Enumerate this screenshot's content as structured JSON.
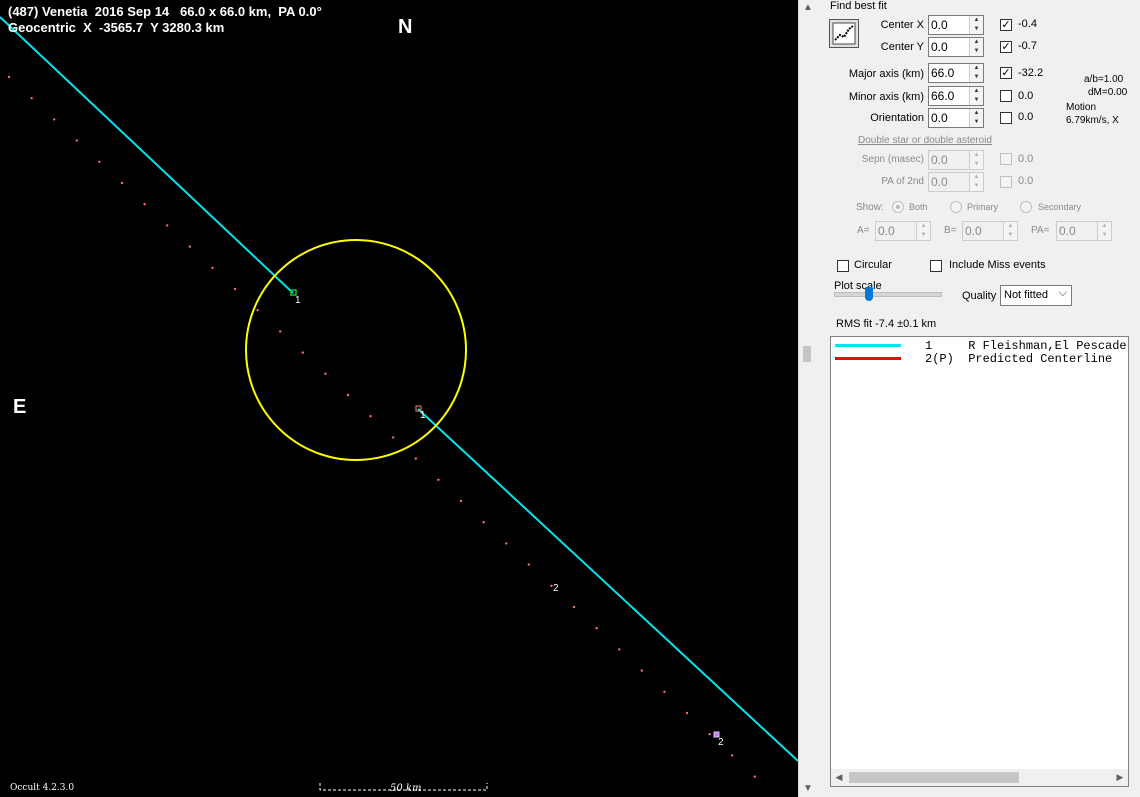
{
  "plot": {
    "header_line1": "(487) Venetia  2016 Sep 14   66.0 x 66.0 km,  PA 0.0°",
    "header_line2": "Geocentric  X  -3565.7  Y 3280.3 km",
    "north": "N",
    "east": "E",
    "version": "Occult 4.2.3.0",
    "scale_label": "50 km",
    "chord_label_1": "1",
    "chord_label_2": "2",
    "colors": {
      "background": "#000000",
      "chord": "#00e5ee",
      "ellipse": "#ffff00",
      "predicted_dots": "#ff6a6a",
      "disappear_marker": "#22c422",
      "reappear_marker": "#ff8080",
      "event2_marker": "#c080ff"
    }
  },
  "panel": {
    "find_best_fit": "Find best fit",
    "fit_button_icon": "chart-fit-icon",
    "center_x": {
      "label": "Center X",
      "value": "0.0",
      "checked": true,
      "result": "-0.4"
    },
    "center_y": {
      "label": "Center Y",
      "value": "0.0",
      "checked": true,
      "result": "-0.7"
    },
    "major_axis": {
      "label": "Major axis (km)",
      "value": "66.0",
      "checked": true,
      "result": "-32.2"
    },
    "minor_axis": {
      "label": "Minor axis (km)",
      "value": "66.0",
      "checked": false,
      "result": "0.0"
    },
    "orientation": {
      "label": "Orientation",
      "value": "0.0",
      "checked": false,
      "result": "0.0"
    },
    "ratio": "a/b=1.00",
    "dm": "dM=0.00",
    "motion_label": "Motion",
    "motion_value": "6.79km/s, X",
    "double_star_heading": "Double star  or  double asteroid",
    "sepn": {
      "label": "Sepn (masec)",
      "value": "0.0",
      "result": "0.0"
    },
    "pa_2nd": {
      "label": "PA of 2nd",
      "value": "0.0",
      "result": "0.0"
    },
    "show_label": "Show:",
    "show_options": [
      "Both",
      "Primary",
      "Secondary"
    ],
    "a_label": "A=",
    "a_value": "0.0",
    "b_label": "B=",
    "b_value": "0.0",
    "pa_label": "PA=",
    "pa_value": "0.0",
    "circular_label": "Circular",
    "include_miss_label": "Include Miss events",
    "plot_scale_label": "Plot scale",
    "quality_label": "Quality",
    "quality_value": "Not fitted",
    "rms_fit": "RMS fit -7.4 ±0.1 km",
    "legend": [
      {
        "line": "1     R Fleishman,El Pescadero",
        "color": "#00e5ee"
      },
      {
        "line": "2(P)  Predicted Centerline",
        "color": "#ff0000"
      }
    ]
  }
}
